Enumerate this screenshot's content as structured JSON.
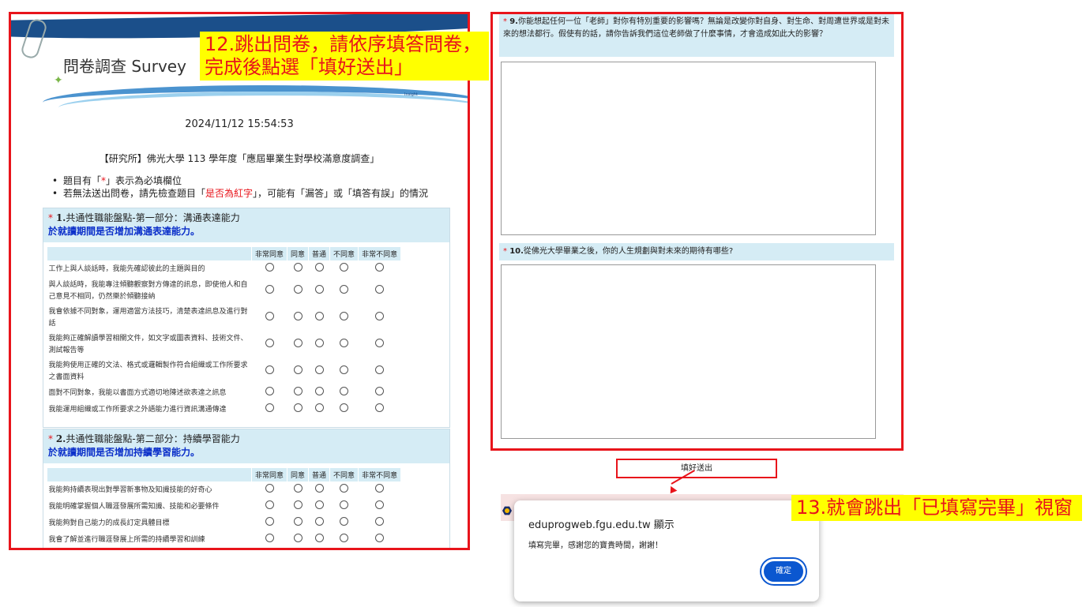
{
  "survey": {
    "title": "問卷調查 Survey",
    "brand_small": "Insight",
    "datetime": "2024/11/12   15:54:53",
    "heading": "【研究所】佛光大學 113 學年度「應屆畢業生對學校滿意度調查」",
    "note1_a": "題目有「",
    "note1_star": "*",
    "note1_b": "」表示為必填欄位",
    "note2_a": "若無法送出問卷，請先檢查題目「",
    "note2_red": "是否為紅字",
    "note2_b": "」，可能有「漏答」或「填答有誤」的情況",
    "likert_headers": [
      "非常同意",
      "同意",
      "普通",
      "不同意",
      "非常不同意"
    ],
    "q1": {
      "star": "*",
      "num": "1.",
      "title": "共通性職能盤點-第一部分：溝通表達能力",
      "sub": "於就讀期間是否增加溝通表達能力。",
      "items": [
        "工作上與人談話時，我能先確認彼此的主題與目的",
        "與人談話時，我能專注傾聽觀察對方傳達的訊息，即使他人和自己意見不相同，仍然樂於傾聽接納",
        "我會依據不同對象，運用適當方法技巧，清楚表達訊息及進行對話",
        "我能夠正確解讀學習相關文件，如文字或圖表資料、技術文件、測試報告等",
        "我能夠使用正確的文法、格式或邏輯製作符合組織或工作所要求之書面資料",
        "面對不同對象，我能以書面方式適切地陳述欲表達之訊息",
        "我能運用組織或工作所要求之外語能力進行資訊溝通傳達"
      ]
    },
    "q2": {
      "star": "*",
      "num": "2.",
      "title": "共通性職能盤點-第二部分：持續學習能力",
      "sub": "於就讀期間是否增加持續學習能力。",
      "items": [
        "我能夠持續表現出對學習新事物及知識技能的好奇心",
        "我能明確掌握個人職涯發展所需知識、技能和必要條件",
        "我能夠對自己能力的成長訂定具體目標",
        "我會了解並進行職涯發展上所需的持續學習和訓練"
      ]
    },
    "q9": {
      "star": "*",
      "num": "9.",
      "text": "你能想起任何一位「老師」對你有特別重要的影響嗎？無論是改變你對自身、對生命、對周遭世界或是對未來的想法都行。假使有的話，請你告訴我們這位老師做了什麼事情，才會造成如此大的影響？"
    },
    "q10": {
      "star": "*",
      "num": "10.",
      "text": "從佛光大學畢業之後，你的人生規劃與對未來的期待有哪些?"
    },
    "submit_label": "填好送出"
  },
  "callouts": {
    "step12": "12.跳出問卷，請依序填答問卷，完成後點選「填好送出」",
    "step13": "13.就會跳出「已填寫完畢」視窗"
  },
  "dialog": {
    "origin": "eduprogweb.fgu.edu.tw 顯示",
    "message": "填寫完畢，感謝您的寶貴時間，謝謝！",
    "ok_label": "確定"
  },
  "colors": {
    "annotation_red": "#e8141b",
    "callout_yellow": "#ffff00",
    "question_header_bg": "#d5ecf5",
    "subtitle_blue": "#0a2ec9",
    "dialog_button_blue": "#0b57d0"
  },
  "icons": [
    "paperclip-icon",
    "leaf-icon",
    "site-logo-icon",
    "arrow-icon"
  ]
}
